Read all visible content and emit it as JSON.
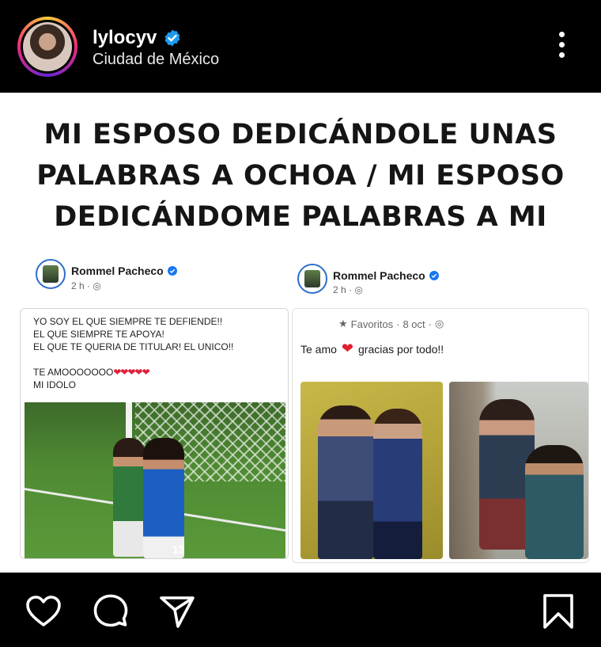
{
  "header": {
    "username": "lylocyv",
    "verified": true,
    "location": "Ciudad de México",
    "icons": {
      "avatar": "profile-avatar",
      "verified": "verified-badge-icon",
      "more": "more-vertical-icon"
    },
    "verified_color": "#1d9bf0"
  },
  "post": {
    "headline": "MI ESPOSO DEDICÁNDOLE UNAS PALABRAS A OCHOA / MI ESPOSO DEDICÁNDOME PALABRAS A MI",
    "left_card": {
      "author": "Rommel Pacheco",
      "time": "2 h",
      "lines": [
        "YO SOY EL QUE SIEMPRE TE DEFIENDE!!",
        "EL QUE SIEMPRE TE APOYA!",
        "EL QUE TE QUERIA DE TITULAR!  EL UNICO!!",
        "",
        "TE AMOOOOOOO",
        "MI IDOLO"
      ],
      "hearts": "❤❤❤❤❤",
      "jersey_number": "13"
    },
    "right_card": {
      "author": "Rommel Pacheco",
      "time": "2 h",
      "favorites": "Favoritos",
      "favorites_date": "8 oct",
      "message_before": "Te amo",
      "message_after": "gracias por todo!!"
    }
  },
  "actions": {
    "like": "heart-icon",
    "comment": "comment-icon",
    "share": "send-icon",
    "save": "bookmark-icon"
  }
}
